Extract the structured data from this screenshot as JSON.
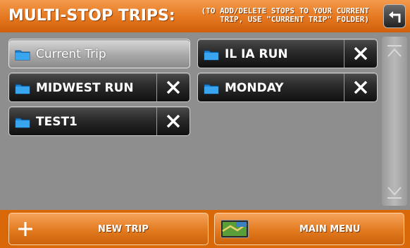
{
  "header": {
    "title": "MULTI-STOP TRIPS:",
    "hint_line1": "(TO ADD/DELETE STOPS TO YOUR CURRENT",
    "hint_line2": "TRIP, USE \"CURRENT TRIP\" FOLDER)"
  },
  "trips": [
    {
      "label": "Current Trip",
      "deletable": false
    },
    {
      "label": "IL IA RUN",
      "deletable": true
    },
    {
      "label": "MIDWEST RUN",
      "deletable": true
    },
    {
      "label": "MONDAY",
      "deletable": true
    },
    {
      "label": "TEST1",
      "deletable": true
    }
  ],
  "footer": {
    "new_trip_label": "NEW TRIP",
    "main_menu_label": "MAIN MENU"
  },
  "colors": {
    "header_orange": "#e4771f",
    "button_dark": "#2a2a2a",
    "folder_blue": "#1e88d8"
  },
  "icons": [
    "back-arrow-icon",
    "folder-icon",
    "delete-x-icon",
    "scroll-up-icon",
    "scroll-down-icon",
    "plus-icon",
    "map-icon"
  ]
}
